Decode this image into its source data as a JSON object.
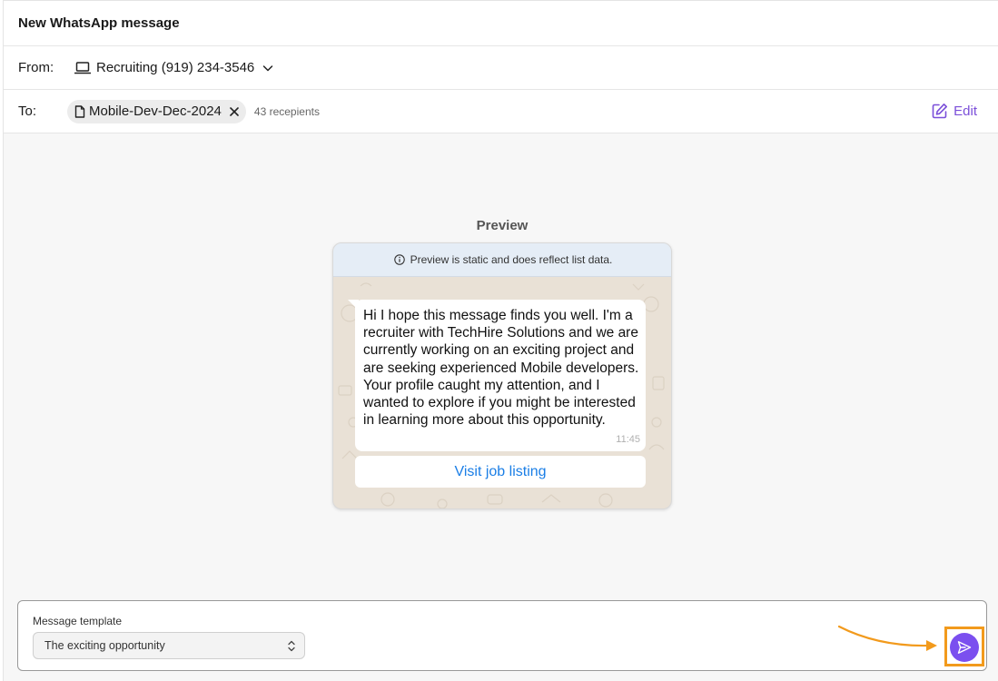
{
  "header": {
    "title": "New WhatsApp message"
  },
  "from": {
    "label": "From:",
    "value": "Recruiting (919) 234-3546",
    "icon": "laptop-icon",
    "dropdown_icon": "chevron-down-icon"
  },
  "to": {
    "label": "To:",
    "chip": {
      "text": "Mobile-Dev-Dec-2024",
      "icon": "document-icon",
      "remove_icon": "close-icon"
    },
    "recipients": "43 recepients",
    "edit": {
      "label": "Edit",
      "icon": "edit-icon"
    }
  },
  "preview": {
    "title": "Preview",
    "notice": "Preview is static and does reflect list data.",
    "message": "Hi I hope this message finds you well. I'm a recruiter with TechHire Solutions and we are currently working on an exciting project and are seeking experienced Mobile developers. Your profile caught my attention, and I wanted to explore if you might be interested in learning more about this opportunity.",
    "time": "11:45",
    "cta_label": "Visit job listing"
  },
  "composer": {
    "template_label": "Message template",
    "template_value": "The exciting opportunity",
    "send_icon": "send-icon"
  },
  "colors": {
    "accent": "#7b4fef",
    "link": "#1a7ee6",
    "annotation": "#f29a1c",
    "notice_bg": "#e5edf6",
    "chat_bg": "#e9e1d6"
  }
}
